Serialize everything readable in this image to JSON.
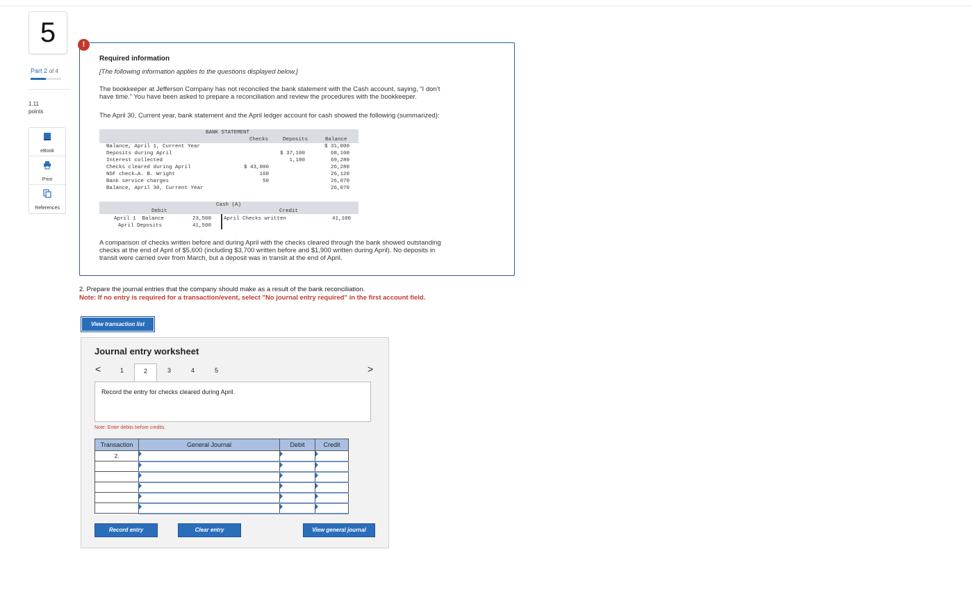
{
  "rail": {
    "question_number": "5",
    "part_label": "Part 2",
    "part_of": "of 4",
    "part_progress": 0.5,
    "points_value": "1.11",
    "points_label": "points",
    "tools": [
      {
        "label": "eBook",
        "icon": "book-icon"
      },
      {
        "label": "Print",
        "icon": "printer-icon"
      },
      {
        "label": "References",
        "icon": "references-icon"
      }
    ]
  },
  "info": {
    "badge": "!",
    "title": "Required information",
    "subtitle": "[The following information applies to the questions displayed below.]",
    "para1_line1": "The bookkeeper at Jefferson Company has not reconciled the bank statement with the Cash account, saying, “I don’t",
    "para1_line2": "have time.” You have been asked to prepare a reconciliation and review the procedures with the bookkeeper.",
    "para2": "The April 30, Current year, bank statement and the April ledger account for cash showed the following (summarized):",
    "para3_line1": "A comparison of checks written before and during April with the checks cleared through the bank showed outstanding",
    "para3_line2": "checks at the end of April of $5,600 (including $3,700 written before and $1,900 written during April). No deposits in",
    "para3_line3": "transit were carried over from March, but a deposit was in transit at the end of April."
  },
  "bank_statement": {
    "title": "BANK STATEMENT",
    "col_checks": "Checks",
    "col_deposits": "Deposits",
    "col_balance": "Balance",
    "rows": [
      {
        "label": "Balance, April 1, Current Year",
        "checks": "",
        "deposits": "",
        "balance": "$ 31,000"
      },
      {
        "label": "Deposits during April",
        "checks": "",
        "deposits": "$ 37,100",
        "balance": "68,100"
      },
      {
        "label": "Interest collected",
        "checks": "",
        "deposits": "1,180",
        "balance": "69,280"
      },
      {
        "label": "Checks cleared during April",
        "checks": "$ 43,000",
        "deposits": "",
        "balance": "26,280"
      },
      {
        "label": "NSF check—A. B. Wright",
        "checks": "160",
        "deposits": "",
        "balance": "26,120"
      },
      {
        "label": "Bank service charges",
        "checks": "50",
        "deposits": "",
        "balance": "26,070"
      },
      {
        "label": "Balance, April 30, Current Year",
        "checks": "",
        "deposits": "",
        "balance": "26,070"
      }
    ]
  },
  "cash_account": {
    "title": "Cash (A)",
    "debit_label": "Debit",
    "credit_label": "Credit",
    "debit_rows": [
      {
        "label": "April 1  Balance",
        "amount": "23,500"
      },
      {
        "label": "April Deposits",
        "amount": "41,500"
      }
    ],
    "credit_rows": [
      {
        "label": "April Checks written",
        "amount": "41,100"
      }
    ]
  },
  "question": {
    "text": "2. Prepare the journal entries that the company should make as a result of the bank reconciliation.",
    "note": "Note: If no entry is required for a transaction/event, select \"No journal entry required\" in the first account field."
  },
  "buttons": {
    "view_transaction_list": "View transaction list",
    "record_entry": "Record entry",
    "clear_entry": "Clear entry",
    "view_general_journal": "View general journal"
  },
  "worksheet": {
    "title": "Journal entry worksheet",
    "pages": [
      "1",
      "2",
      "3",
      "4",
      "5"
    ],
    "active_page": "2",
    "prev": "<",
    "next": ">",
    "instruction": "Record the entry for checks cleared during April.",
    "note": "Note: Enter debits before credits.",
    "columns": {
      "transaction": "Transaction",
      "general_journal": "General Journal",
      "debit": "Debit",
      "credit": "Credit"
    },
    "rows": [
      {
        "transaction": "2.",
        "account": "",
        "debit": "",
        "credit": ""
      },
      {
        "transaction": "",
        "account": "",
        "debit": "",
        "credit": ""
      },
      {
        "transaction": "",
        "account": "",
        "debit": "",
        "credit": ""
      },
      {
        "transaction": "",
        "account": "",
        "debit": "",
        "credit": ""
      },
      {
        "transaction": "",
        "account": "",
        "debit": "",
        "credit": ""
      },
      {
        "transaction": "",
        "account": "",
        "debit": "",
        "credit": ""
      }
    ]
  },
  "colors": {
    "accent": "#2a6ebb",
    "alert": "#c0392b",
    "table_header": "#a9c0e2"
  }
}
